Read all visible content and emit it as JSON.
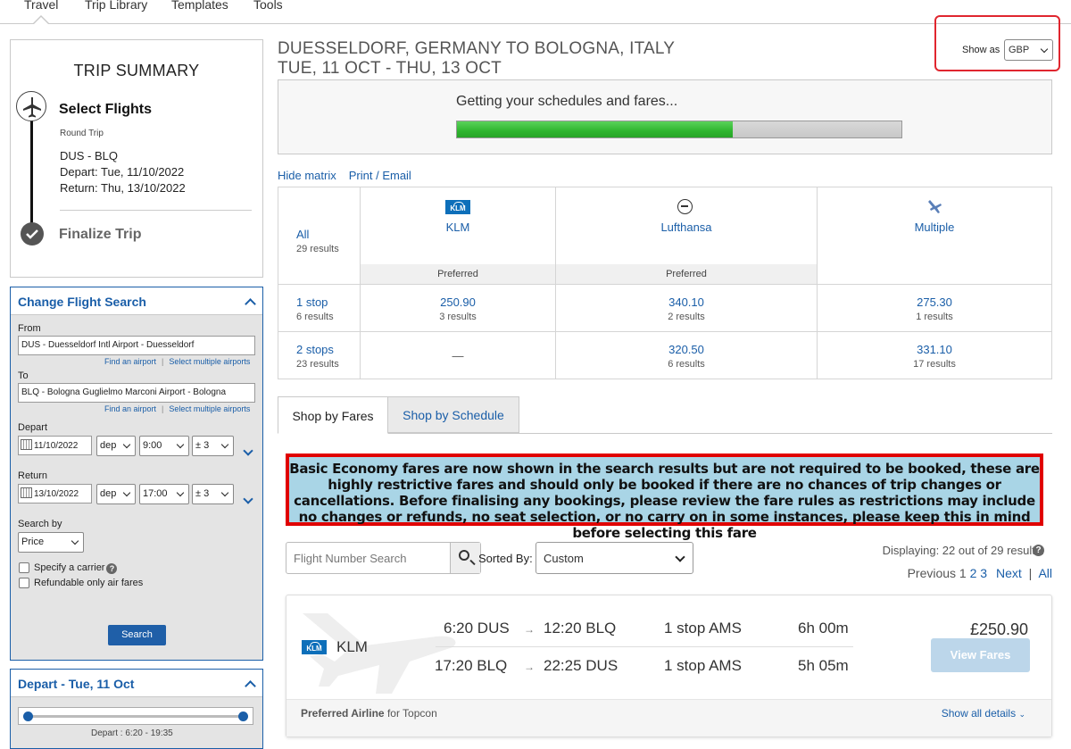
{
  "nav": {
    "tabs": [
      "Travel",
      "Trip Library",
      "Templates",
      "Tools"
    ]
  },
  "summary": {
    "title": "TRIP SUMMARY",
    "step1": "Select Flights",
    "trip_type": "Round Trip",
    "route": "DUS - BLQ",
    "depart": "Depart: Tue, 11/10/2022",
    "return": "Return: Thu, 13/10/2022",
    "step2": "Finalize Trip"
  },
  "search": {
    "title": "Change Flight Search",
    "from_label": "From",
    "from_value": "DUS - Duesseldorf Intl Airport - Duesseldorf",
    "to_label": "To",
    "to_value": "BLQ - Bologna Guglielmo Marconi Airport - Bologna",
    "find_airport": "Find an airport",
    "select_multiple": "Select multiple airports",
    "depart_label": "Depart",
    "depart_date": "11/10/2022",
    "depart_mode": "dep",
    "depart_time": "9:00",
    "depart_window": "± 3",
    "return_label": "Return",
    "return_date": "13/10/2022",
    "return_mode": "dep",
    "return_time": "17:00",
    "return_window": "± 3",
    "search_by_label": "Search by",
    "search_by_value": "Price",
    "carrier_label": "Specify a carrier",
    "refundable_label": "Refundable only air fares",
    "search_button": "Search"
  },
  "depart_filter": {
    "title": "Depart - Tue, 11 Oct",
    "range": "Depart : 6:20 - 19:35"
  },
  "header": {
    "route_line1": "DUESSELDORF, GERMANY TO BOLOGNA, ITALY",
    "route_line2": "TUE, 11 OCT - THU, 13 OCT",
    "show_as_label": "Show as",
    "currency": "GBP"
  },
  "progress": {
    "text": "Getting your schedules and fares...",
    "fraction": 0.62
  },
  "matrix_links": {
    "hide": "Hide matrix",
    "print": "Print / Email"
  },
  "matrix": {
    "all_label": "All",
    "all_count": "29 results",
    "airlines": [
      {
        "name": "KLM",
        "logo": "klm-logo",
        "tag": "Preferred"
      },
      {
        "name": "Lufthansa",
        "logo": "lufthansa-logo",
        "tag": "Preferred"
      },
      {
        "name": "Multiple",
        "logo": "multiple-airlines-icon",
        "tag": ""
      }
    ],
    "rows": [
      {
        "label": "1 stop",
        "count": "6 results",
        "cells": [
          {
            "price": "250.90",
            "count": "3 results"
          },
          {
            "price": "340.10",
            "count": "2 results"
          },
          {
            "price": "275.30",
            "count": "1 results"
          }
        ]
      },
      {
        "label": "2 stops",
        "count": "23 results",
        "cells": [
          {
            "price": "—",
            "count": ""
          },
          {
            "price": "320.50",
            "count": "6 results"
          },
          {
            "price": "331.10",
            "count": "17 results"
          }
        ]
      }
    ]
  },
  "tabs": {
    "fares": "Shop by Fares",
    "schedule": "Shop by Schedule"
  },
  "notice": "Basic Economy fares are now shown in the search results but are not required to be booked, these are highly restrictive fares and should only be booked if there are no chances of trip changes or cancellations. Before finalising any bookings, please review the fare rules as restrictions may include no changes or refunds, no seat selection, or no carry on in some instances, please keep this in mind before selecting this fare",
  "results_bar": {
    "flight_search_placeholder": "Flight Number Search",
    "sorted_by_label": "Sorted By:",
    "sorted_by_value": "Custom",
    "displaying": "Displaying: 22 out of 29 results.",
    "previous": "Previous",
    "pages": [
      "1",
      "2",
      "3"
    ],
    "next": "Next",
    "all": "All"
  },
  "result": {
    "airline": "KLM",
    "outbound": {
      "dep": "6:20 DUS",
      "arr": "12:20 BLQ",
      "stops": "1 stop AMS",
      "duration": "6h 00m"
    },
    "inbound": {
      "dep": "17:20 BLQ",
      "arr": "22:25 DUS",
      "stops": "1 stop AMS",
      "duration": "5h 05m"
    },
    "price": "£250.90",
    "view_fares": "View Fares",
    "preferred_strong": "Preferred Airline",
    "preferred_rest": "for Topcon",
    "show_all": "Show all details"
  },
  "colors": {
    "accent": "#1a5ea8",
    "notice_bg": "#a9d5e6",
    "notice_border": "#e00000",
    "progress_green": "#2fb52f",
    "highlight_box": "#e0262f"
  }
}
